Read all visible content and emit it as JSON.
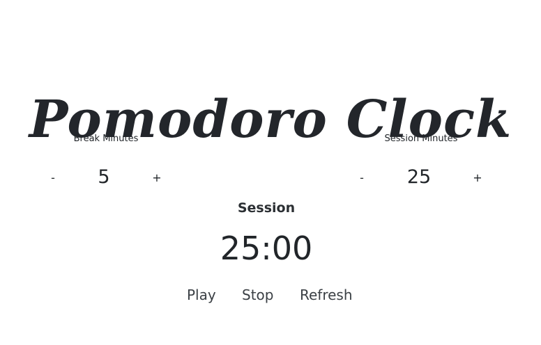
{
  "app": {
    "title": "Pomodoro Clock"
  },
  "break": {
    "label": "Break Minutes",
    "decrement": "-",
    "value": "5",
    "increment": "+"
  },
  "session": {
    "label": "Session Minutes",
    "decrement": "-",
    "value": "25",
    "increment": "+"
  },
  "timer": {
    "status": "Session",
    "display": "25:00"
  },
  "controls": {
    "play": "Play",
    "stop": "Stop",
    "refresh": "Refresh"
  },
  "colors": {
    "background": "#ffffff",
    "text": "#212529"
  }
}
